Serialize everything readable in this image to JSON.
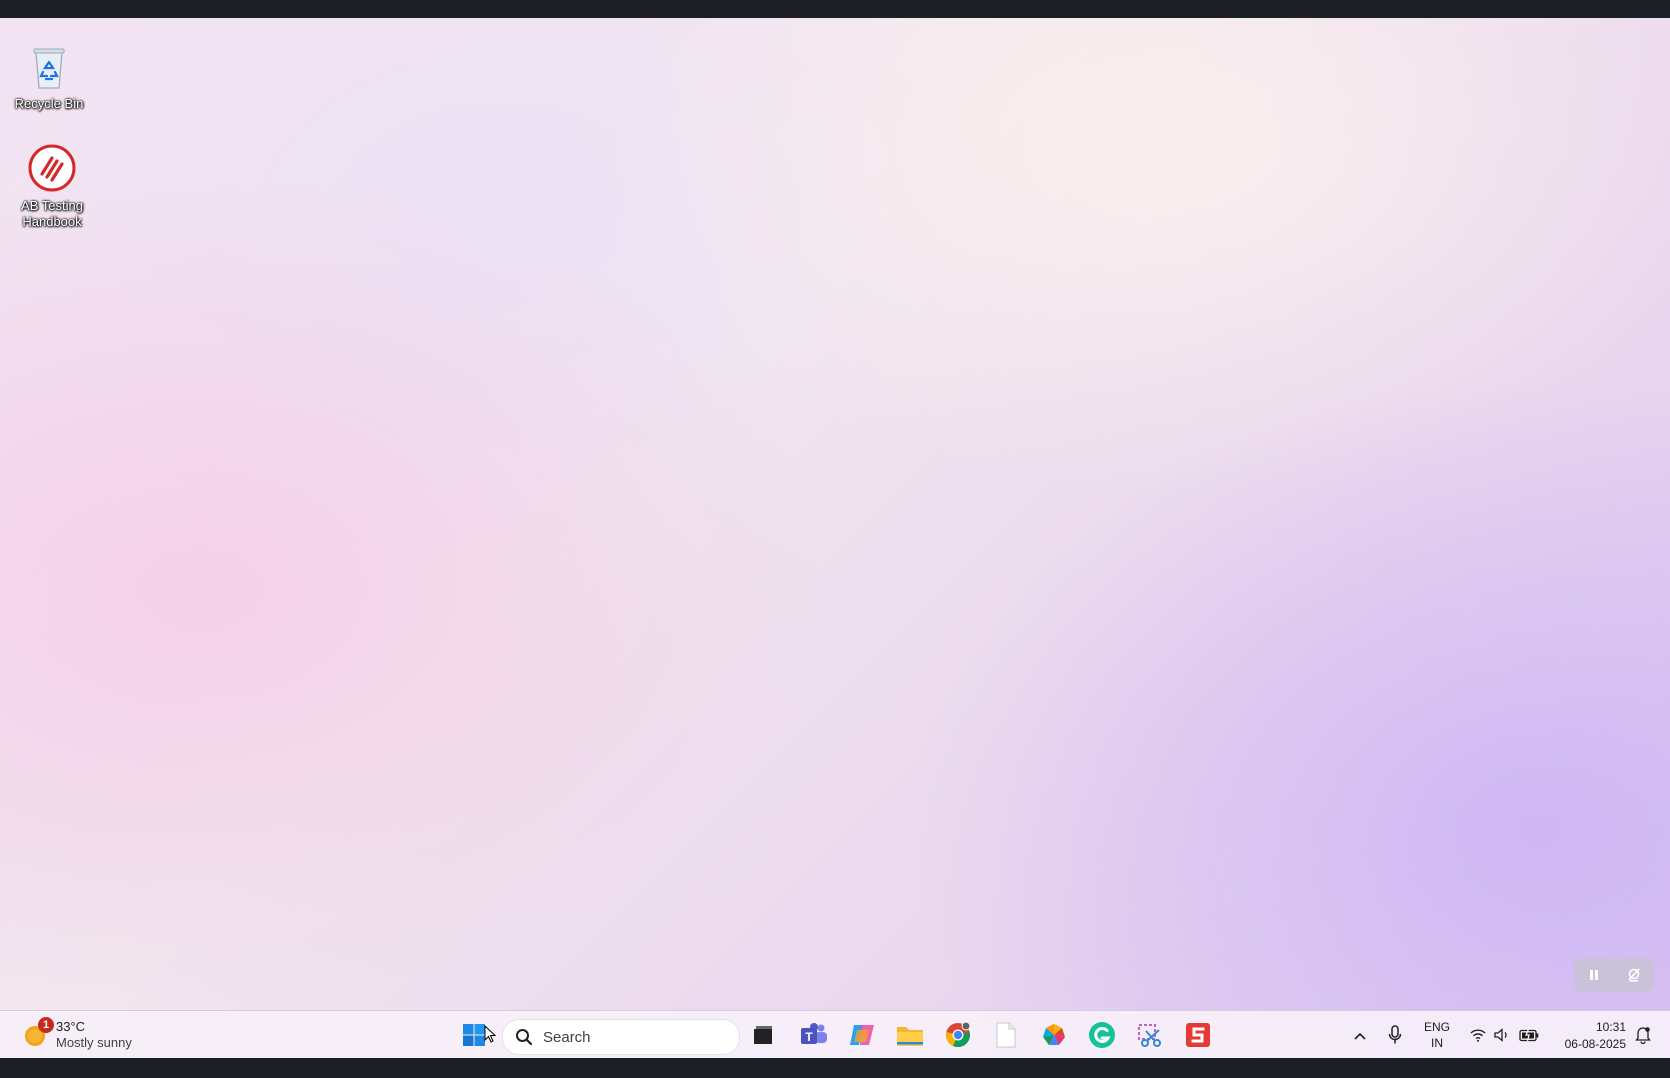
{
  "desktop": {
    "icons": [
      {
        "label": "Recycle Bin",
        "icon": "recycle-bin-icon"
      },
      {
        "label": "AB Testing Handbook",
        "icon": "ab-testing-handbook-icon"
      }
    ]
  },
  "taskbar": {
    "weather": {
      "temp": "33°C",
      "condition": "Mostly sunny",
      "badge": "1",
      "icon": "weather-sun-icon"
    },
    "search": {
      "placeholder": "Search"
    },
    "apps": [
      {
        "name": "start",
        "icon": "windows-start-icon"
      },
      {
        "name": "task-view",
        "icon": "task-view-icon"
      },
      {
        "name": "teams",
        "icon": "teams-icon"
      },
      {
        "name": "copilot",
        "icon": "copilot-icon"
      },
      {
        "name": "file-explorer",
        "icon": "folder-icon"
      },
      {
        "name": "chrome",
        "icon": "chrome-icon",
        "active": true
      },
      {
        "name": "notepad",
        "icon": "blank-document-icon"
      },
      {
        "name": "photos",
        "icon": "photos-icon"
      },
      {
        "name": "grammarly",
        "icon": "grammarly-icon"
      },
      {
        "name": "snipping-tool",
        "icon": "snipping-tool-icon"
      },
      {
        "name": "wps-office",
        "icon": "wps-office-icon"
      }
    ],
    "tray": {
      "language_line1": "ENG",
      "language_line2": "IN",
      "time": "10:31",
      "date": "06-08-2025"
    }
  },
  "colors": {
    "accent_blue": "#1a73e8",
    "ab_red": "#d62828",
    "badge_red": "#c42b1c"
  }
}
